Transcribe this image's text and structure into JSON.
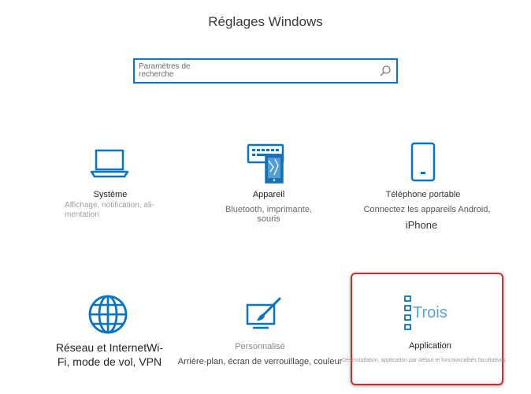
{
  "window": {
    "title": "Réglages Windows"
  },
  "search": {
    "placeholder": "Paramètres de recherche",
    "icon": "search-icon"
  },
  "colors": {
    "accent": "#0a74c4",
    "highlight_border": "#d62a2a"
  },
  "tiles": [
    {
      "label": "Système",
      "description": "Affichage, notification, ali- mentation",
      "icon": "laptop-icon"
    },
    {
      "label": "Appareil",
      "description": "Bluetooth, imprimante, souris",
      "icon": "keyboard-device-icon"
    },
    {
      "label": "Téléphone portable",
      "description": "Connectez les appareils Android,",
      "description_extra": "iPhone",
      "icon": "phone-icon"
    },
    {
      "label": "Réseau et InternetWi-Fi, mode de vol, VPN",
      "icon": "globe-icon"
    },
    {
      "label": "Personnalisé",
      "description": "Arrière-plan, écran de verrouillage, couleur",
      "icon": "paint-brush-icon"
    },
    {
      "label": "Application",
      "description": "Désinstallation, application par défaut et fonctionnalités facultatives",
      "icon_text": "Trois",
      "icon": "app-list-icon"
    }
  ]
}
